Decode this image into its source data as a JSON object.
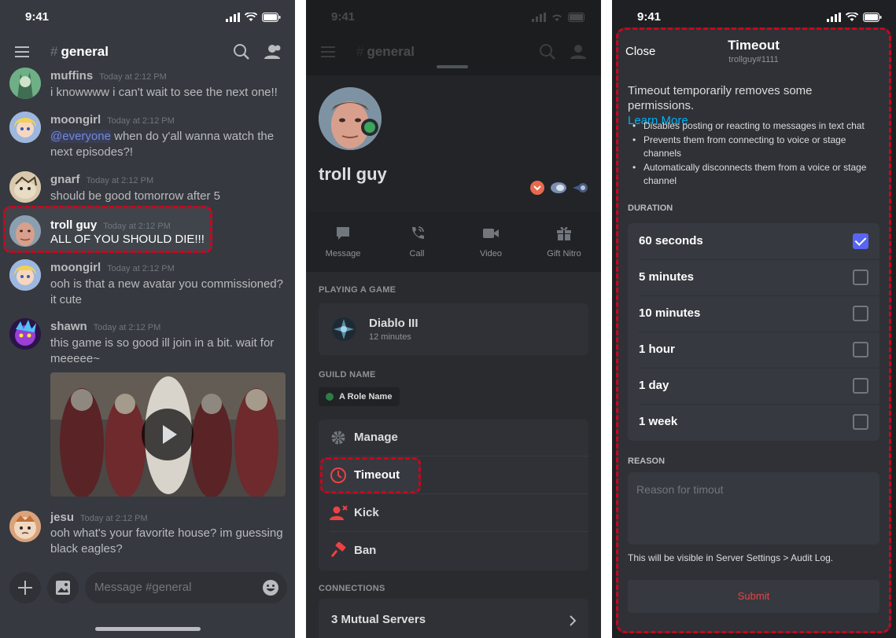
{
  "status": {
    "time": "9:41"
  },
  "chat": {
    "channel": "general",
    "hash": "#",
    "composer_placeholder": "Message #general",
    "messages": [
      {
        "author": "muffins",
        "time": "Today at 2:12 PM",
        "text": "i knowwww i can't wait to see the next one!!"
      },
      {
        "author": "moongirl",
        "time": "Today at 2:12 PM",
        "mention": "@everyone",
        "text": " when do y'all wanna watch the next episodes?!"
      },
      {
        "author": "gnarf",
        "time": "Today at 2:12 PM",
        "text": "should be good tomorrow after 5"
      },
      {
        "author": "troll guy",
        "time": "Today at 2:12 PM",
        "text": "ALL OF YOU SHOULD DIE!!!"
      },
      {
        "author": "moongirl",
        "time": "Today at 2:12 PM",
        "text": "ooh is that a new avatar you commissioned? it cute"
      },
      {
        "author": "shawn",
        "time": "Today at 2:12 PM",
        "text": "this game is so good ill join in a bit. wait for meeeee~"
      },
      {
        "author": "jesu",
        "time": "Today at 2:12 PM",
        "text": "ooh what's your favorite house? im guessing black eagles?"
      }
    ]
  },
  "profile": {
    "name": "troll guy",
    "actions": [
      "Message",
      "Call",
      "Video",
      "Gift Nitro"
    ],
    "playing_label": "PLAYING A GAME",
    "game": {
      "name": "Diablo III",
      "time": "12 minutes"
    },
    "guild_label": "GUILD NAME",
    "role": "A Role Name",
    "mod_actions": [
      "Manage",
      "Timeout",
      "Kick",
      "Ban"
    ],
    "connections_label": "CONNECTIONS",
    "mutual": "3 Mutual Servers"
  },
  "timeout_modal": {
    "close": "Close",
    "title": "Timeout",
    "subtitle": "trollguy#1111",
    "description": "Timeout temporarily removes some permissions.",
    "learn_more": "Learn More",
    "bullets": [
      "Disables posting or reacting to messages in text chat",
      "Prevents them from connecting to voice or stage channels",
      "Automatically disconnects them from a voice or stage channel"
    ],
    "duration_label": "DURATION",
    "durations": [
      {
        "label": "60 seconds",
        "checked": true
      },
      {
        "label": "5 minutes",
        "checked": false
      },
      {
        "label": "10 minutes",
        "checked": false
      },
      {
        "label": "1 hour",
        "checked": false
      },
      {
        "label": "1 day",
        "checked": false
      },
      {
        "label": "1 week",
        "checked": false
      }
    ],
    "reason_label": "REASON",
    "reason_placeholder": "Reason for timout",
    "audit_note": "This will be visible in Server Settings > Audit Log.",
    "submit": "Submit"
  },
  "colors": {
    "accent": "#5865f2",
    "danger": "#ed4245",
    "highlight": "#d0021b",
    "link": "#00b0f4",
    "online": "#3ba55d"
  }
}
